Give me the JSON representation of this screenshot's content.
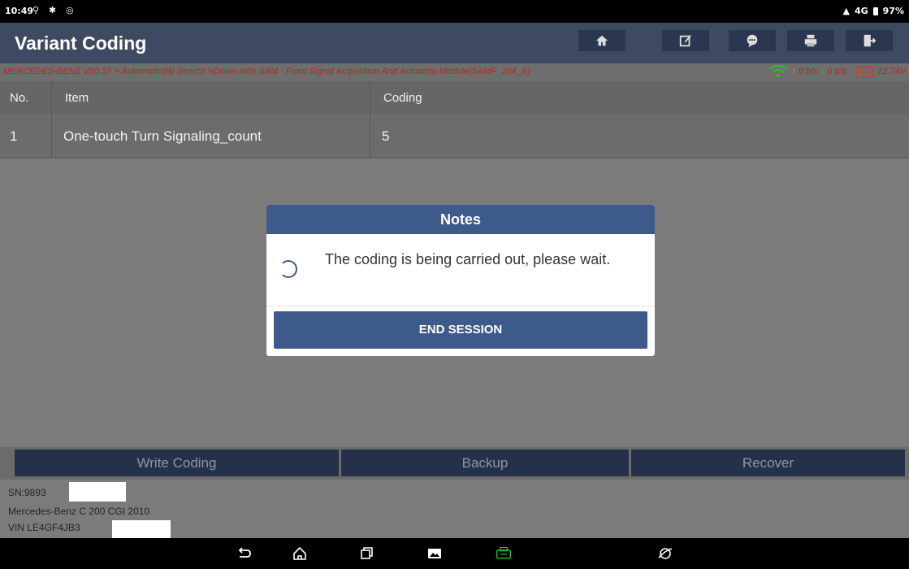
{
  "status_bar": {
    "time": "10:49",
    "left_icons": [
      "usb-icon",
      "bluetooth-icon",
      "chat-icon"
    ],
    "network": "4G",
    "battery": "97%"
  },
  "header": {
    "title": "Variant Coding",
    "buttons": [
      "home-icon",
      "edit-icon",
      "message-icon",
      "print-icon",
      "exit-icon"
    ]
  },
  "breadcrumb": {
    "path": "MERCEDES-BENZ V50.37 > Automatically Search >Driver-side SAM - Front Signal Acquisition And Actuation Module(SAMF_204_X)",
    "upload": "0 b/s",
    "download": "0 b/s",
    "voltage": "12.74V"
  },
  "table": {
    "headers": [
      "No.",
      "Item",
      "Coding"
    ],
    "rows": [
      {
        "no": "1",
        "item": "One-touch Turn Signaling_count",
        "coding": "5"
      }
    ]
  },
  "dialog": {
    "title": "Notes",
    "message": "The coding is being carried out, please wait.",
    "button": "END SESSION"
  },
  "actions": {
    "write": "Write Coding",
    "backup": "Backup",
    "recover": "Recover"
  },
  "info": {
    "sn": "SN:9893",
    "vehicle": "Mercedes-Benz C 200 CGI 2010",
    "vin": "VIN LE4GF4JB3"
  },
  "navbar": [
    "back-icon",
    "home-icon",
    "recents-icon",
    "gallery-icon",
    "vci-icon",
    "browser-icon"
  ],
  "colors": {
    "header": "#3e4a62",
    "dialog_accent": "#3e5a8a",
    "breadcrumb_text": "#b52a1f",
    "button_dark": "#25304a"
  }
}
